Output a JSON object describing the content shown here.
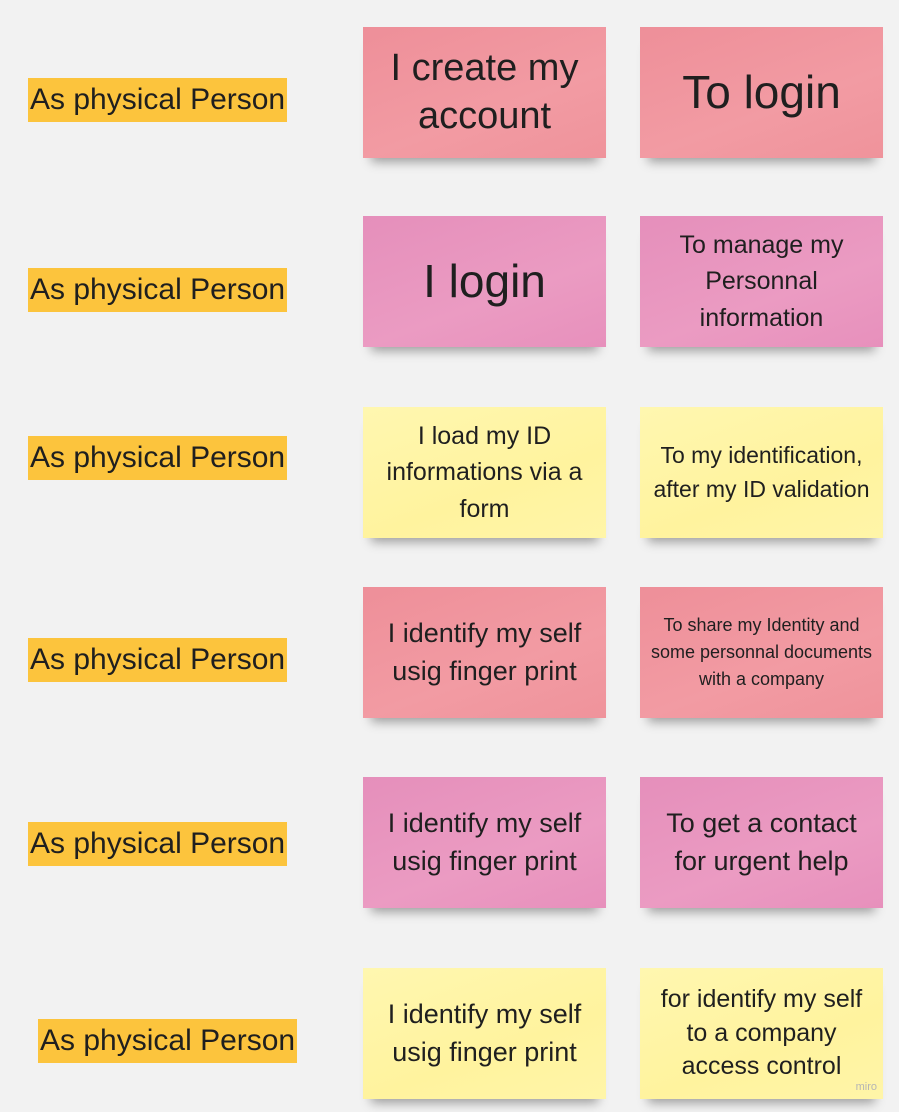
{
  "colors": {
    "label": "#fcc43d",
    "red_note": "#f0939b",
    "pink_note": "#e993bd",
    "yellow_note": "#fff5a6",
    "background": "#f2f2f2"
  },
  "rows": [
    {
      "label": "As physical Person",
      "action": "I create my account",
      "goal": "To login"
    },
    {
      "label": "As physical Person",
      "action": "I login",
      "goal": "To manage my Personnal information"
    },
    {
      "label": "As physical Person",
      "action": "I load my ID informations via a form",
      "goal": "To my identification, after my ID validation"
    },
    {
      "label": "As physical Person",
      "action": "I identify my self usig finger print",
      "goal": "To share my Identity and some personnal documents with a company"
    },
    {
      "label": "As physical Person",
      "action": "I identify my self usig finger print",
      "goal": "To get a contact for urgent help"
    },
    {
      "label": "As physical Person",
      "action": "I identify my self usig finger print",
      "goal": "for identify my self to a company access control"
    }
  ],
  "watermark": "miro"
}
